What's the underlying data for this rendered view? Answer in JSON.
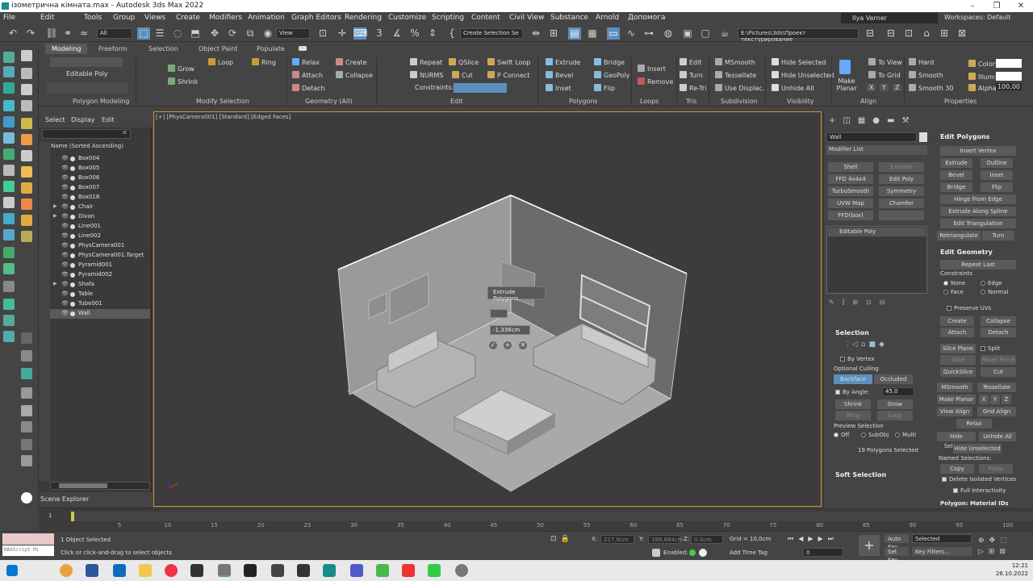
{
  "window": {
    "title": "ізометрична кімната.max - Autodesk 3ds Max 2022"
  },
  "menu": [
    "File",
    "Edit",
    "Tools",
    "Group",
    "Views",
    "Create",
    "Modifiers",
    "Animation",
    "Graph Editors",
    "Rendering",
    "Customize",
    "Scripting",
    "Content",
    "Civil View",
    "Substance",
    "Arnold",
    "Допомога"
  ],
  "user": "Ilya Verner",
  "workspace": "Workspaces: Default",
  "toolbar": {
    "filter": "All",
    "view": "View",
    "create_selection": "Create Selection Se",
    "path": "E:\\Pictures\\3ds\\Проект текстурирование"
  },
  "ribbon": {
    "tabs": [
      "Modeling",
      "Freeform",
      "Selection",
      "Object Paint",
      "Populate"
    ],
    "panels": [
      "Polygon Modeling",
      "Modify Selection",
      "Geometry (All)",
      "Edit",
      "Polygons",
      "Loops",
      "Tris",
      "Subdivision",
      "Visibility",
      "Align",
      "Properties"
    ],
    "editable_poly": "Editable Poly",
    "modify_selection": [
      "Grow",
      "Shrink",
      "Loop",
      "Ring"
    ],
    "geometry": [
      "Relax",
      "Create",
      "Attach",
      "Collapse",
      "Detach"
    ],
    "edit": [
      "Repeat",
      "QSlice",
      "Swift Loop",
      "NURMS",
      "Cut",
      "P Connect",
      "Constraints:"
    ],
    "polygons": [
      "Extrude",
      "Bridge",
      "Bevel",
      "GeoPoly",
      "Inset",
      "Flip"
    ],
    "loops": [
      "Insert",
      "Remove"
    ],
    "tris": [
      "Edit",
      "Turn",
      "Re-Tri"
    ],
    "subdivision": [
      "MSmooth",
      "Tessellate",
      "Use Displac..."
    ],
    "visibility": [
      "Hide Selected",
      "Hide Unselected",
      "Unhide All"
    ],
    "align": [
      "Make Planar",
      "To View",
      "To Grid",
      "X",
      "Y",
      "Z"
    ],
    "properties": [
      "Hard",
      "Smooth",
      "Smooth 30",
      "Color:",
      "Illum:",
      "Alpha:",
      "100,00"
    ]
  },
  "explorer": {
    "tabs": [
      "Select",
      "Display",
      "Edit"
    ],
    "header": "Name (Sorted Ascending)",
    "items": [
      "Box004",
      "Box005",
      "Box006",
      "Box007",
      "Box018",
      "Chair",
      "Divan",
      "Line001",
      "Line002",
      "PhysCamera001",
      "PhysCamera001.Target",
      "Pyramid001",
      "Pyramid002",
      "Shafa",
      "Table",
      "Tube001",
      "Wall"
    ],
    "footer": "Scene Explorer"
  },
  "viewport": {
    "label": "[+] [PhysCamera001] [Standard] [Edged Faces]",
    "caddy_title": "Extrude Polygons",
    "caddy_value": "-1,336cm"
  },
  "command_panel": {
    "object_name": "Wall",
    "modifier_list": "Modifier List",
    "modifier_buttons": [
      "Shell",
      "Extrude",
      "FFD 4x4x4",
      "Edit Poly",
      "TurboSmooth",
      "Symmetry",
      "UVW Map",
      "Chamfer",
      "FFD(box)"
    ],
    "stack_item": "Editable Poly",
    "selection": {
      "title": "Selection",
      "by_vertex": "By Vertex",
      "optional_culling": "Optional Culling",
      "backface": "Backface",
      "occluded": "Occluded",
      "by_angle": "By Angle:",
      "angle_value": "45,0",
      "shrink": "Shrink",
      "grow": "Grow",
      "ring": "Ring",
      "loop": "Loop",
      "preview_selection": "Preview Selection",
      "preview_off": "Off",
      "preview_subobj": "SubObj",
      "preview_multi": "Multi",
      "status": "19 Polygons Selected"
    },
    "soft_selection": "Soft Selection",
    "edit_polygons": {
      "title": "Edit Polygons",
      "buttons": [
        "Insert Vertex",
        "Extrude",
        "Outline",
        "Bevel",
        "Inset",
        "Bridge",
        "Flip",
        "Hinge From Edge",
        "Extrude Along Spline",
        "Edit Triangulation",
        "Retriangulate",
        "Turn"
      ]
    },
    "edit_geometry": {
      "title": "Edit Geometry",
      "repeat_last": "Repeat Last",
      "constraints": "Constraints",
      "constraint_options": [
        "None",
        "Edge",
        "Face",
        "Normal"
      ],
      "preserve_uvs": "Preserve UVs",
      "buttons": [
        "Create",
        "Collapse",
        "Attach",
        "Detach",
        "Slice Plane",
        "Split",
        "Slice",
        "Reset Plane",
        "QuickSlice",
        "Cut",
        "MSmooth",
        "Tessellate",
        "Make Planar",
        "X",
        "Y",
        "Z",
        "View Align",
        "Grid Align",
        "Relax",
        "Hide Selected",
        "Unhide All",
        "Hide Unselected"
      ],
      "named_selections": "Named Selections:",
      "copy": "Copy",
      "paste": "Paste",
      "delete_isolated": "Delete Isolated Vertices",
      "full_interactivity": "Full Interactivity",
      "polygon_material_ids": "Polygon: Material IDs"
    }
  },
  "timeline": {
    "frame": "1",
    "ticks": [
      "5",
      "10",
      "15",
      "20",
      "25",
      "30",
      "35",
      "40",
      "45",
      "50",
      "55",
      "60",
      "65",
      "70",
      "75",
      "80",
      "85",
      "90",
      "95",
      "100"
    ]
  },
  "status": {
    "maxscript": "MAXScript Mi",
    "selected": "1 Object Selected",
    "prompt": "Click or click-and-drag to select objects",
    "x_label": "X:",
    "x_value": "217,8cm",
    "y_label": "Y:",
    "y_value": "188,684cm",
    "z_label": "Z:",
    "z_value": "0,0cm",
    "grid": "Grid = 10,0cm",
    "enabled": "Enabled:",
    "add_time_tag": "Add Time Tag",
    "auto_key": "Auto Key",
    "selected_dd": "Selected",
    "set_key": "Set Key",
    "key_filters": "Key Filters...",
    "frame_field": "0"
  },
  "taskbar": {
    "time": "12:21",
    "date": "26.10.2022"
  }
}
